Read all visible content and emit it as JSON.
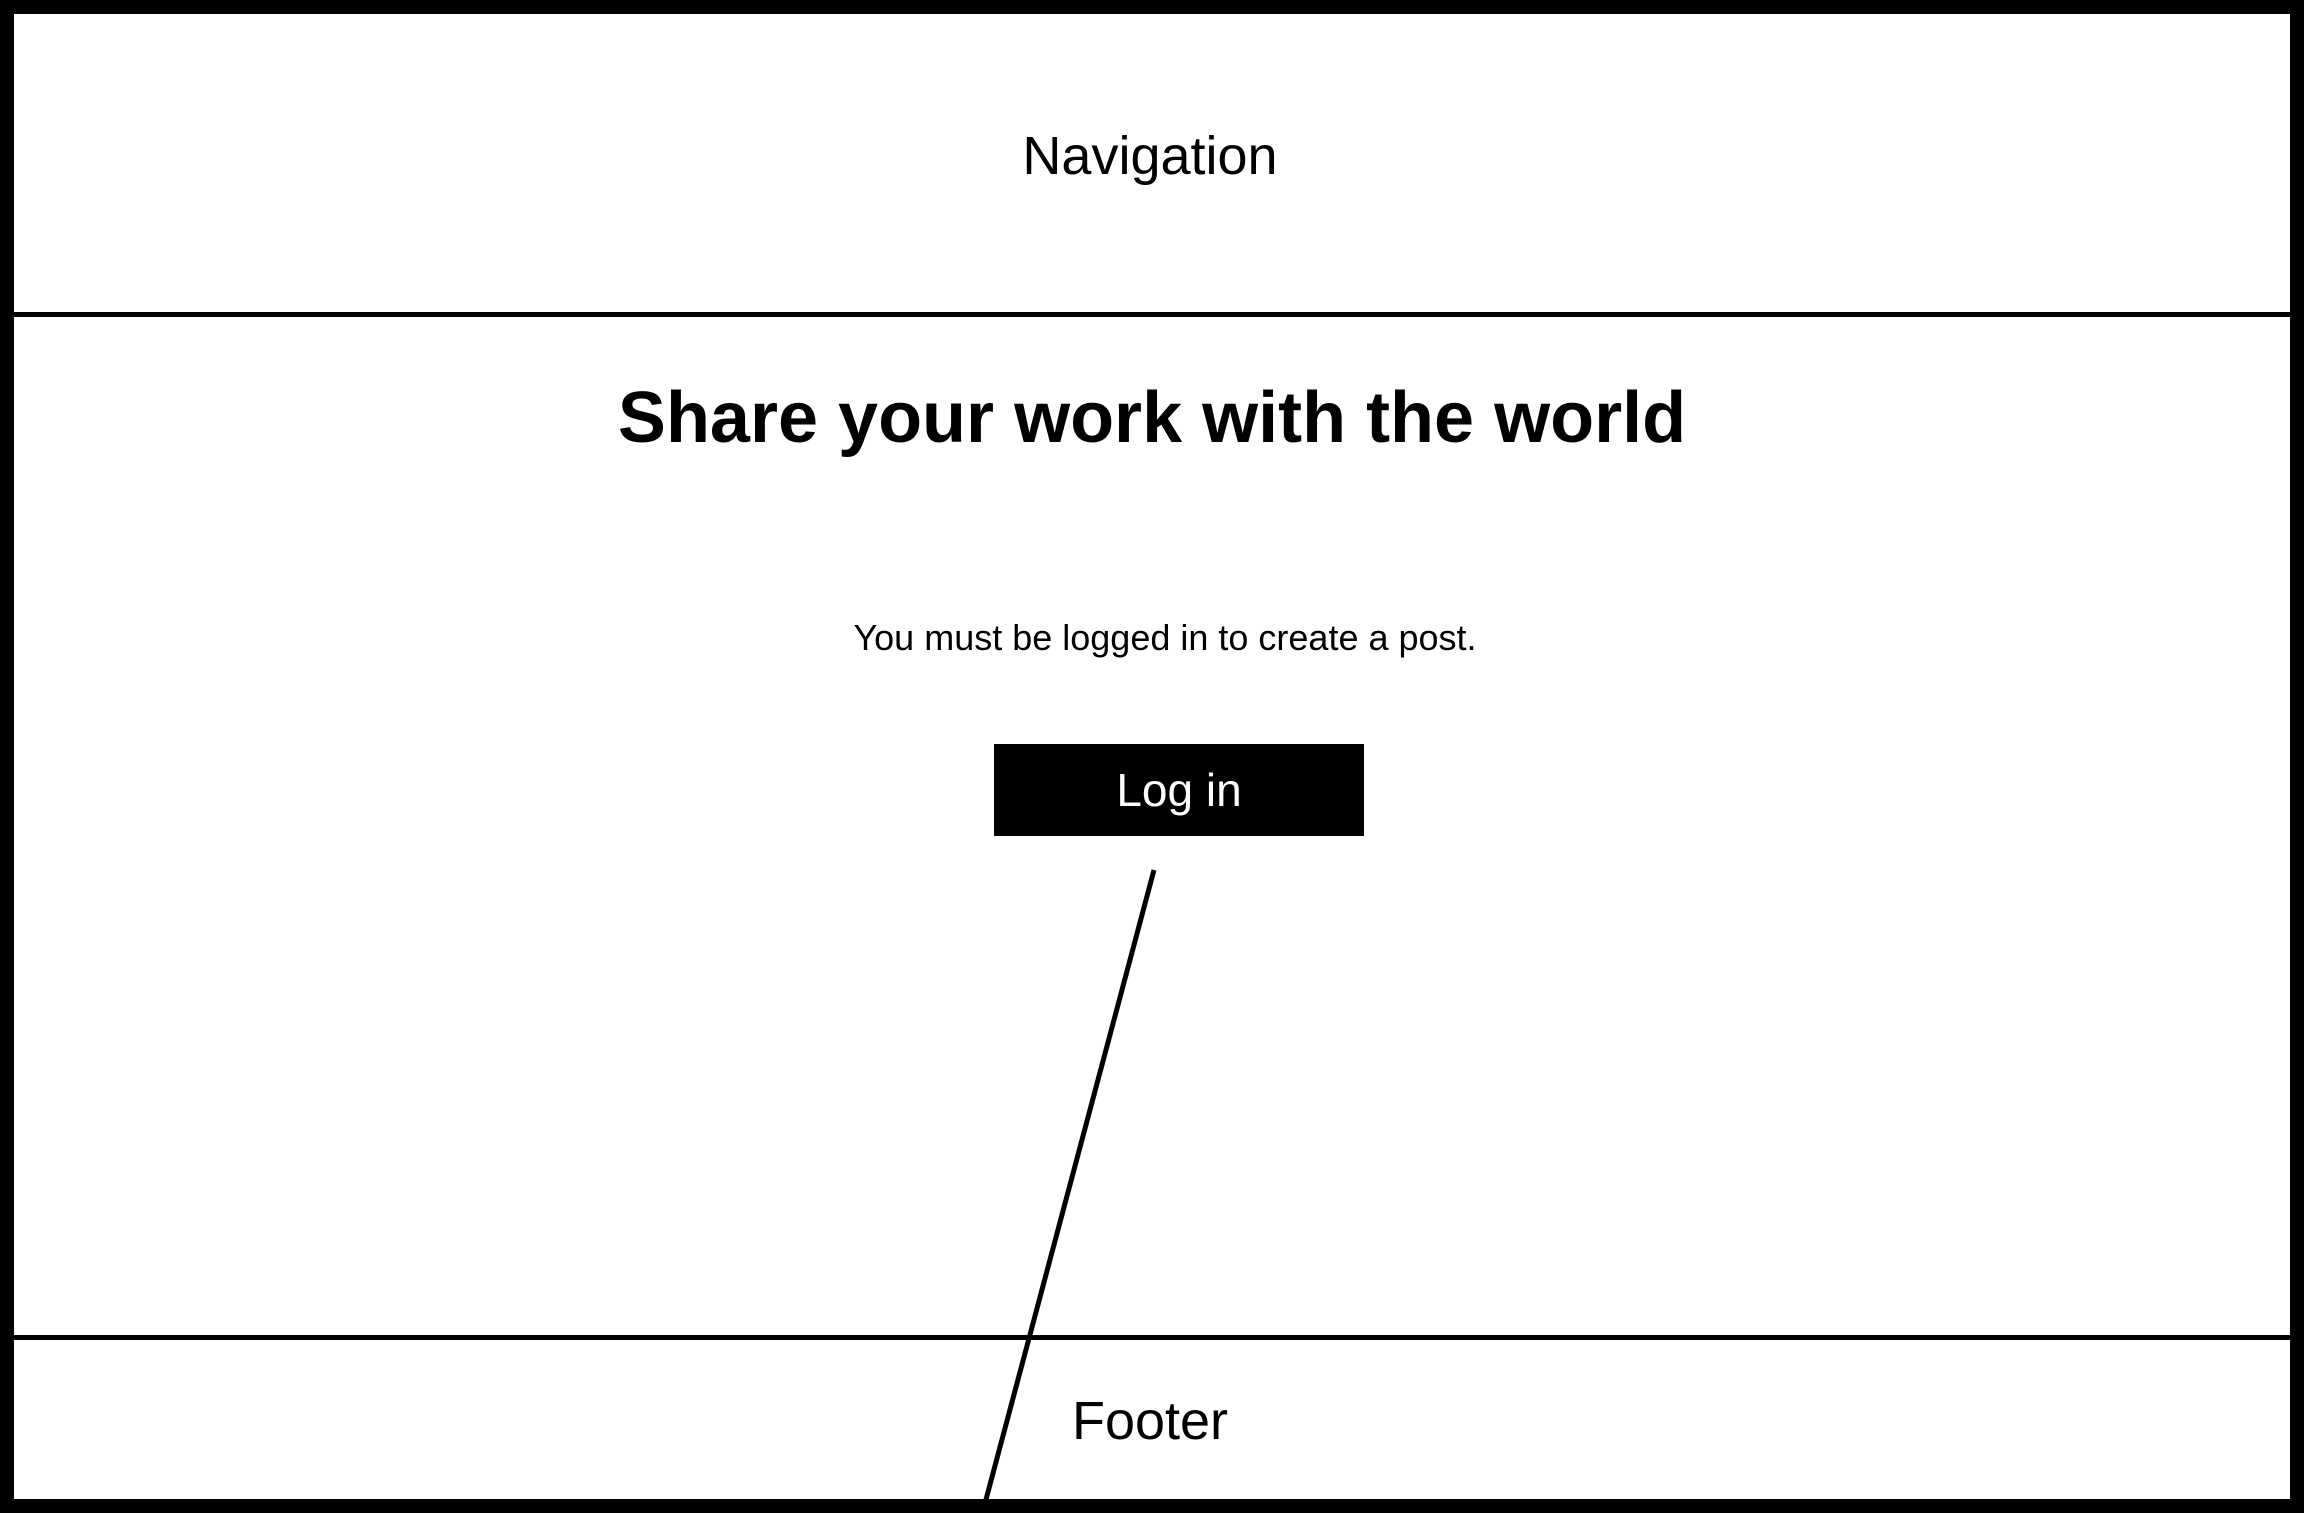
{
  "nav": {
    "label": "Navigation"
  },
  "main": {
    "heading": "Share your work with the world",
    "message": "You must be logged in to create a post.",
    "login_label": "Log in"
  },
  "footer": {
    "label": "Footer"
  },
  "colors": {
    "ink": "#000000",
    "background": "#ffffff",
    "button_text": "#ffffff"
  }
}
